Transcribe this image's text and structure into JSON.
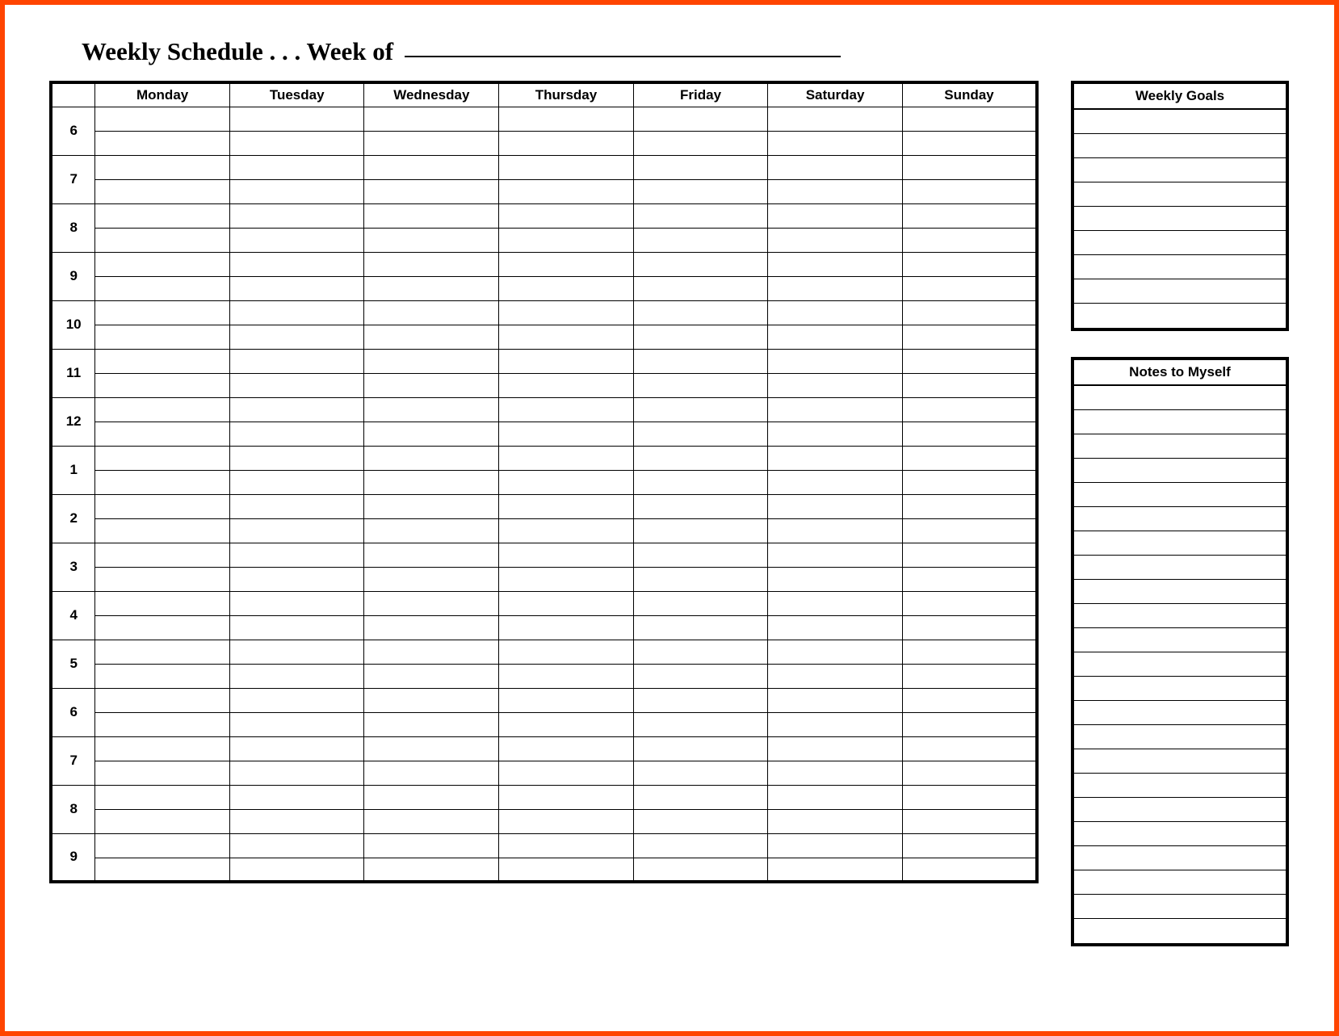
{
  "title_prefix": "Weekly Schedule . . . Week of",
  "week_of_value": "",
  "days": [
    "Monday",
    "Tuesday",
    "Wednesday",
    "Thursday",
    "Friday",
    "Saturday",
    "Sunday"
  ],
  "hours": [
    "6",
    "7",
    "8",
    "9",
    "10",
    "11",
    "12",
    "1",
    "2",
    "3",
    "4",
    "5",
    "6",
    "7",
    "8",
    "9"
  ],
  "rows_per_hour": 2,
  "sidebar": {
    "goals": {
      "title": "Weekly Goals",
      "line_count": 9
    },
    "notes": {
      "title": "Notes to Myself",
      "line_count": 23
    }
  }
}
